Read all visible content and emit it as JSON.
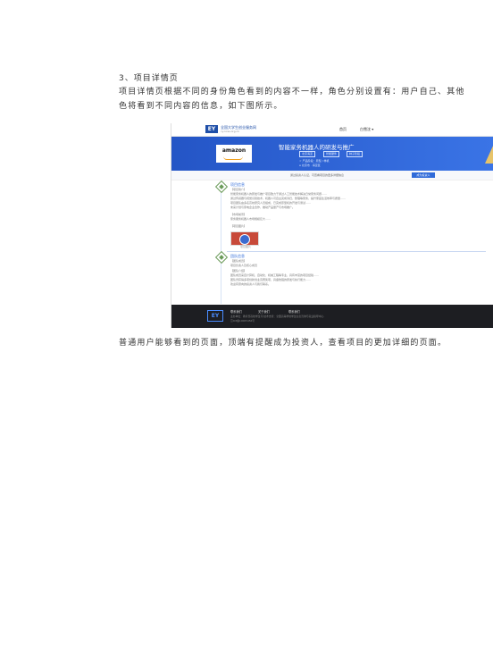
{
  "doc": {
    "heading": "3、项目详情页",
    "para1": "项目详情页根据不同的身份角色看到的内容不一样，角色分别设置有：用户自己、其他",
    "para2": "色将看到不同内容的信息，如下图所示。",
    "para3": "普通用户能够看到的页面，顶端有提醒成为投资人，查看项目的更加详细的页面。"
  },
  "screenshot": {
    "logo_text": "EY",
    "site_name": "全国大学生创业服务网",
    "site_sub": "cy.ncss.org.cn",
    "nav_home": "首页",
    "nav_user": "白雪沈 ▾",
    "banner": {
      "brand": "amazon",
      "title": "智能家务机器人的研发与推广",
      "tags": [
        "北京海淀",
        "智能硬件",
        "种子阶段"
      ],
      "info1": "☆ 产品阶段：原型 / 样机",
      "info2": "⌂ 北京市 · 海淀区"
    },
    "invest_note": "通过投资人认证，可查看项目的更多详细信息",
    "invest_button": "成为投资人",
    "section1": {
      "title": "项目信息",
      "label_intro": "【项目简介】",
      "text1": "智能家务机器人的研发与推广项目致力于通过人工智能技术解决日常家务问题……",
      "text2": "通过传感器与视觉识别技术，机器人可自主完成清扫、整理等家务，提升家庭生活效率与质量……",
      "text3": "项目团队由多名高校研究人员组成，已完成原型机的开发与测试……",
      "text4": "未来计划与家电企业合作，推动产品量产与市场推广。",
      "label_market": "【市场前景】",
      "text5": "家务服务机器人市场规模巨大……",
      "label_images": "【项目图片】",
      "thumb_caption": "项目图片"
    },
    "section2": {
      "title": "团队信息",
      "label_members": "【团队成员】",
      "text1": "项目负责人及核心成员",
      "label_exp": "【团队介绍】",
      "text2": "团队成员来自计算机、自动化、机械工程等专业，具有丰富的项目经验……",
      "text3": "团队曾获得多项创新创业竞赛奖项，具备较强的研发与执行能力……",
      "text4": "欢迎有意向的投资人与我们联系。"
    },
    "footer": {
      "logo": "EY",
      "links": [
        "联系我们",
        "关于我们",
        "联系我们"
      ],
      "text1": "主办单位：教育部高校学生司   技术支持：全国高等学校学生信息咨询与就业指导中心",
      "text2": "京ICP备10005456号"
    }
  }
}
